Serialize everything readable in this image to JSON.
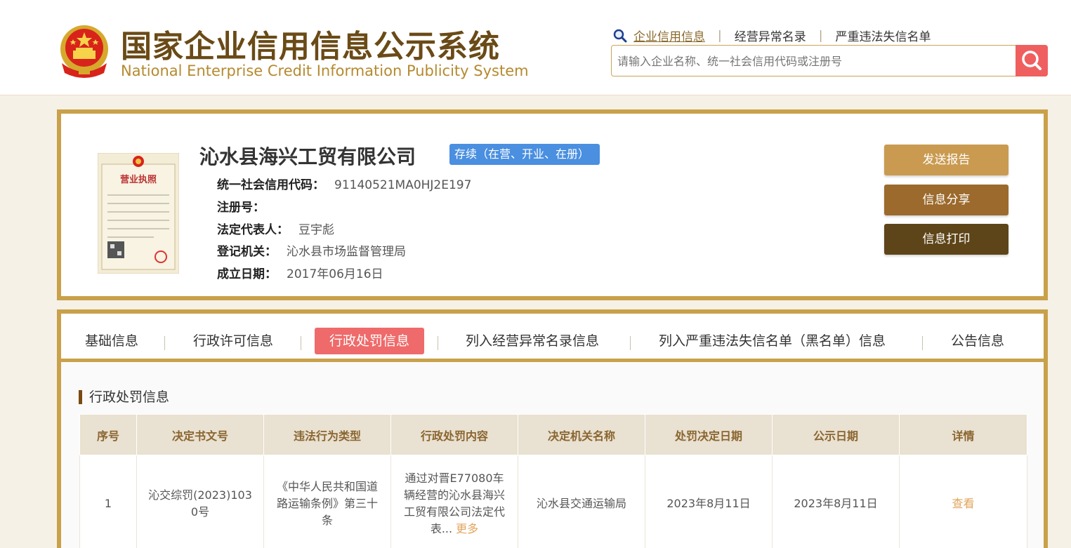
{
  "header": {
    "title_cn": "国家企业信用信息公示系统",
    "title_en": "National Enterprise Credit Information Publicity System",
    "emblem_icon": "national-emblem-icon",
    "nav": {
      "credit_info": "企业信用信息",
      "abnormal_list": "经营异常名录",
      "serious_violation": "严重违法失信名单",
      "separator": "|"
    },
    "search": {
      "placeholder": "请输入企业名称、统一社会信用代码或注册号",
      "button_icon": "search-icon"
    }
  },
  "company": {
    "name": "沁水县海兴工贸有限公司",
    "status": "存续（在营、开业、在册）",
    "license_icon": "business-license-icon",
    "fields": {
      "credit_code_label": "统一社会信用代码：",
      "credit_code": "91140521MA0HJ2E197",
      "reg_no_label": "注册号：",
      "reg_no": "",
      "legal_rep_label": "法定代表人：",
      "legal_rep": "豆宇彪",
      "reg_authority_label": "登记机关：",
      "reg_authority": "沁水县市场监督管理局",
      "est_date_label": "成立日期：",
      "est_date": "2017年06月16日"
    },
    "actions": {
      "send_report": "发送报告",
      "share": "信息分享",
      "print": "信息打印"
    }
  },
  "tabs": [
    {
      "label": "基础信息"
    },
    {
      "label": "行政许可信息"
    },
    {
      "label": "行政处罚信息"
    },
    {
      "label": "列入经营异常名录信息"
    },
    {
      "label": "列入严重违法失信名单（黑名单）信息"
    },
    {
      "label": "公告信息"
    }
  ],
  "active_tab": 2,
  "section": {
    "title": "行政处罚信息",
    "columns": [
      "序号",
      "决定书文号",
      "违法行为类型",
      "行政处罚内容",
      "决定机关名称",
      "处罚决定日期",
      "公示日期",
      "详情"
    ],
    "rows": [
      {
        "index": "1",
        "doc_no": "沁交综罚(2023)1030号",
        "violation_type": "《中华人民共和国道路运输条例》第三十条",
        "content": "通过对晋E77080车辆经营的沁水县海兴工贸有限公司法定代表...",
        "more": "更多",
        "authority": "沁水县交通运输局",
        "decision_date": "2023年8月11日",
        "publish_date": "2023年8月11日",
        "detail": "查看"
      }
    ]
  },
  "colors": {
    "brand_gold": "#c9a14a",
    "title_brown": "#6a4a16",
    "status_blue": "#4a8fe0",
    "active_tab_red": "#ef6a6a",
    "search_red": "#ef5f5f"
  }
}
